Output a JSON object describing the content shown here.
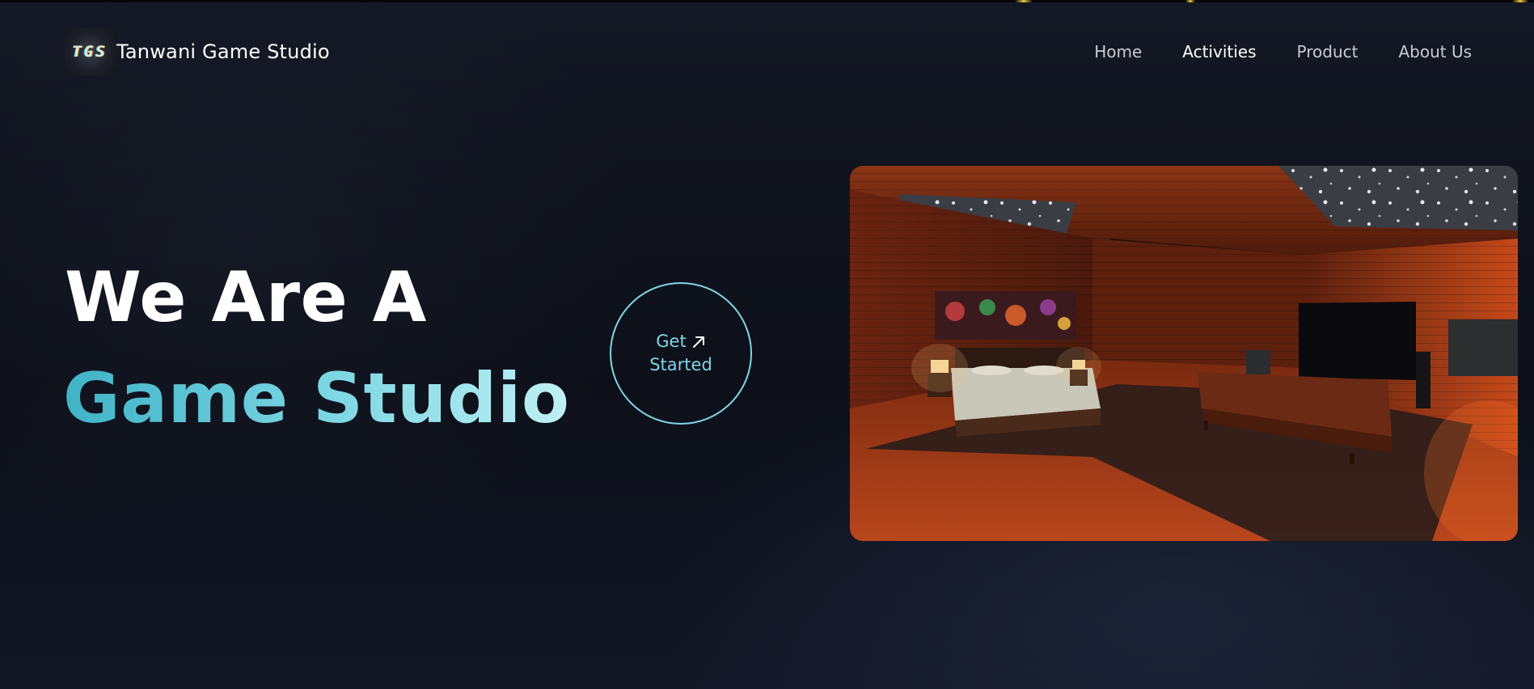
{
  "header": {
    "logo_text": "TGS",
    "brand_name": "Tanwani Game Studio",
    "nav": [
      {
        "label": "Home",
        "active": false
      },
      {
        "label": "Activities",
        "active": true
      },
      {
        "label": "Product",
        "active": false
      },
      {
        "label": "About Us",
        "active": false
      }
    ]
  },
  "hero": {
    "line1": "We Are A",
    "line2": "Game Studio",
    "cta_line1": "Get",
    "cta_line2": "Started",
    "cta_icon": "arrow-up-right-icon",
    "image_description_icon": "room-render-image"
  },
  "colors": {
    "background": "#0e111a",
    "accent": "#7fd6e6",
    "heading": "#ffffff",
    "nav_text": "#c9cbd2"
  }
}
